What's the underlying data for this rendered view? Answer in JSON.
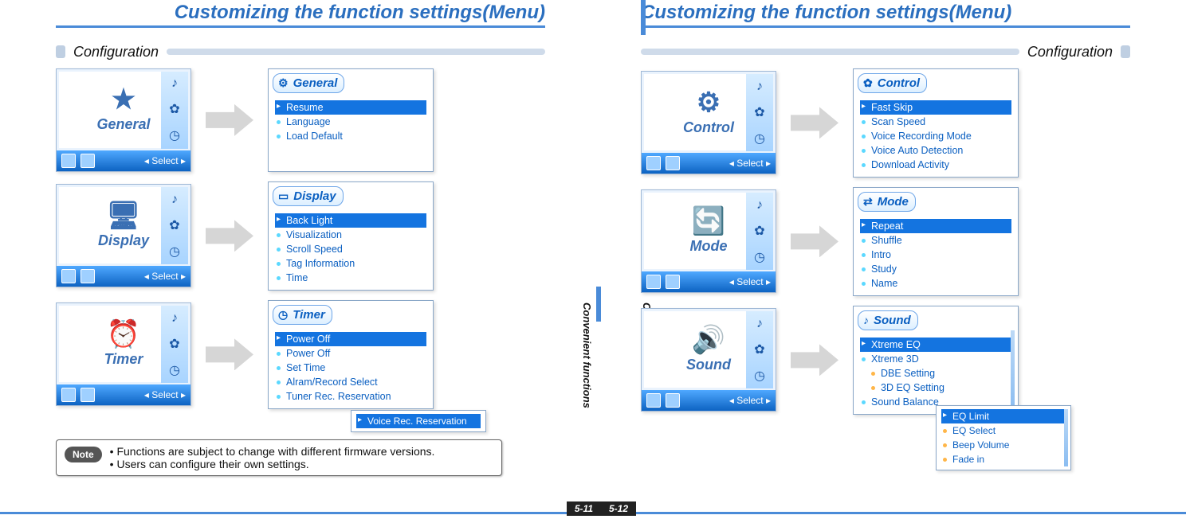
{
  "page_left": {
    "title": "Customizing the function settings(Menu)",
    "section": "Configuration",
    "side_label": "Convenient functions",
    "page_number": "5-11",
    "note_label": "Note",
    "note_lines": [
      "Functions are subject to change with different firmware versions.",
      "Users can configure their own settings."
    ],
    "rows": [
      {
        "thumb_label": "General",
        "thumb_icon": "★",
        "select_label": "Select",
        "panel_title": "General",
        "panel_icon": "⚙",
        "items": [
          {
            "label": "Resume",
            "selected": true
          },
          {
            "label": "Language"
          },
          {
            "label": "Load Default"
          }
        ]
      },
      {
        "thumb_label": "Display",
        "thumb_icon": "🖥",
        "select_label": "Select",
        "panel_title": "Display",
        "panel_icon": "▭",
        "items": [
          {
            "label": "Back Light",
            "selected": true
          },
          {
            "label": "Visualization"
          },
          {
            "label": "Scroll Speed"
          },
          {
            "label": "Tag Information"
          },
          {
            "label": "Time"
          }
        ]
      },
      {
        "thumb_label": "Timer",
        "thumb_icon": "⏰",
        "select_label": "Select",
        "panel_title": "Timer",
        "panel_icon": "◷",
        "items": [
          {
            "label": "Power Off",
            "selected": true
          },
          {
            "label": "Power Off"
          },
          {
            "label": "Set Time"
          },
          {
            "label": "Alram/Record Select"
          },
          {
            "label": "Tuner Rec. Reservation"
          }
        ],
        "extra_items": [
          {
            "label": "Voice Rec. Reservation",
            "selected": true
          }
        ]
      }
    ]
  },
  "page_right": {
    "title": "Customizing the function settings(Menu)",
    "section": "Configuration",
    "side_label": "Convenient functions",
    "page_number": "5-12",
    "rows": [
      {
        "thumb_label": "Control",
        "thumb_icon": "⚙",
        "select_label": "Select",
        "panel_title": "Control",
        "panel_icon": "✿",
        "items": [
          {
            "label": "Fast Skip",
            "selected": true
          },
          {
            "label": "Scan Speed"
          },
          {
            "label": "Voice Recording Mode"
          },
          {
            "label": "Voice Auto Detection"
          },
          {
            "label": "Download Activity"
          }
        ]
      },
      {
        "thumb_label": "Mode",
        "thumb_icon": "🔄",
        "select_label": "Select",
        "panel_title": "Mode",
        "panel_icon": "⇄",
        "items": [
          {
            "label": "Repeat",
            "selected": true
          },
          {
            "label": "Shuffle"
          },
          {
            "label": "Intro"
          },
          {
            "label": "Study"
          },
          {
            "label": "Name"
          }
        ]
      },
      {
        "thumb_label": "Sound",
        "thumb_icon": "🔊",
        "select_label": "Select",
        "panel_title": "Sound",
        "panel_icon": "♪",
        "has_scroll": true,
        "items": [
          {
            "label": "Xtreme EQ",
            "selected": true
          },
          {
            "label": "Xtreme 3D"
          },
          {
            "label": "DBE Setting",
            "sub": true
          },
          {
            "label": "3D EQ Setting",
            "sub": true
          },
          {
            "label": "Sound Balance"
          }
        ],
        "extra_items": [
          {
            "label": "EQ Limit",
            "selected": true
          },
          {
            "label": "EQ Select"
          },
          {
            "label": "Beep Volume"
          },
          {
            "label": "Fade in"
          }
        ],
        "extra_has_scroll": true
      }
    ]
  }
}
